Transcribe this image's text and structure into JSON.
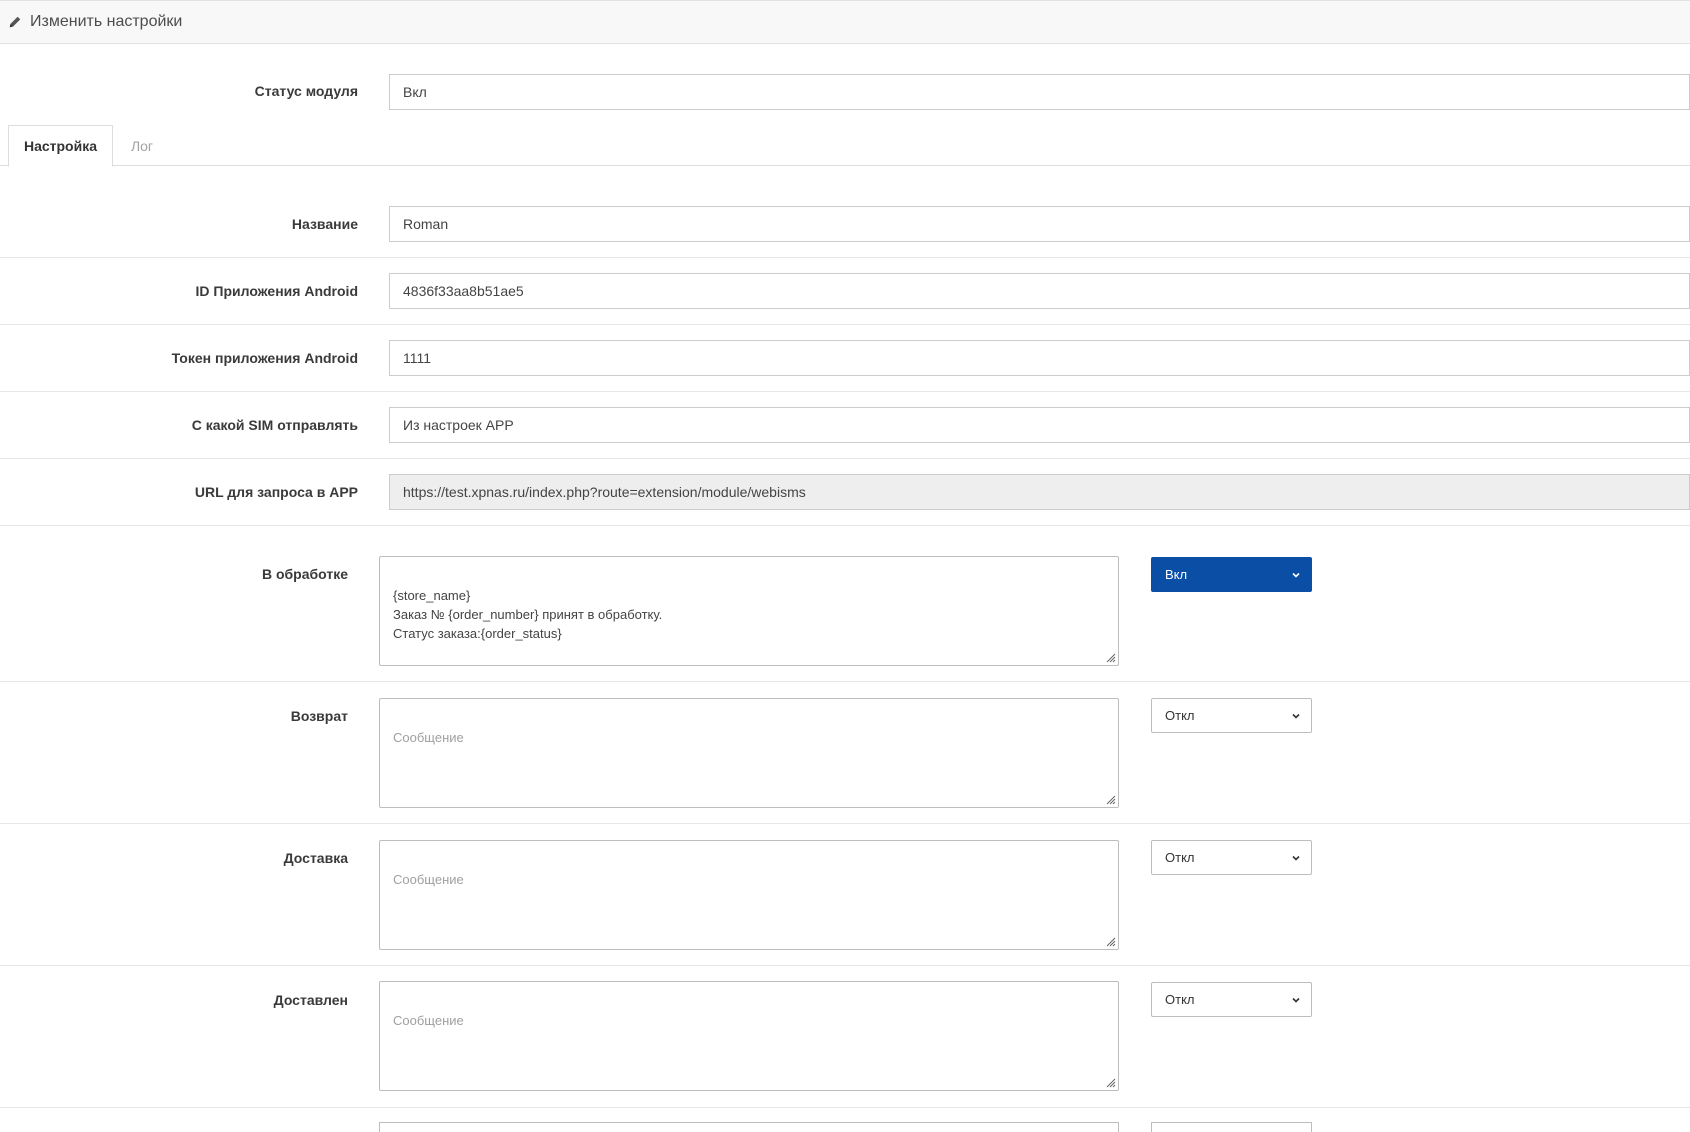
{
  "header": {
    "title": "Изменить настройки",
    "icon": "pencil-icon"
  },
  "module_status": {
    "label": "Статус модуля",
    "value": "Вкл"
  },
  "tabs": [
    {
      "label": "Настройка",
      "active": true
    },
    {
      "label": "Лог",
      "active": false
    }
  ],
  "fields": {
    "name": {
      "label": "Название",
      "value": "Roman"
    },
    "app_id": {
      "label": "ID Приложения Android",
      "value": "4836f33aa8b51ae5"
    },
    "token": {
      "label": "Токен приложения Android",
      "value": "1111"
    },
    "sim": {
      "label": "С какой SIM отправлять",
      "value": "Из настроек APP"
    },
    "url": {
      "label": "URL для запроса в APP",
      "value": "https://test.xpnas.ru/index.php?route=extension/module/webisms"
    }
  },
  "statuses": [
    {
      "label": "В обработке",
      "message": "{store_name}\nЗаказ № {order_number} принят в обработку.\nСтатус заказа:{order_status}",
      "placeholder": "Сообщение",
      "state": "Вкл"
    },
    {
      "label": "Возврат",
      "message": "",
      "placeholder": "Сообщение",
      "state": "Откл"
    },
    {
      "label": "Доставка",
      "message": "",
      "placeholder": "Сообщение",
      "state": "Откл"
    },
    {
      "label": "Доставлен",
      "message": "",
      "placeholder": "Сообщение",
      "state": "Откл"
    }
  ],
  "colors": {
    "accent": "#0a4ea6",
    "readonly_bg": "#eeeeee"
  }
}
